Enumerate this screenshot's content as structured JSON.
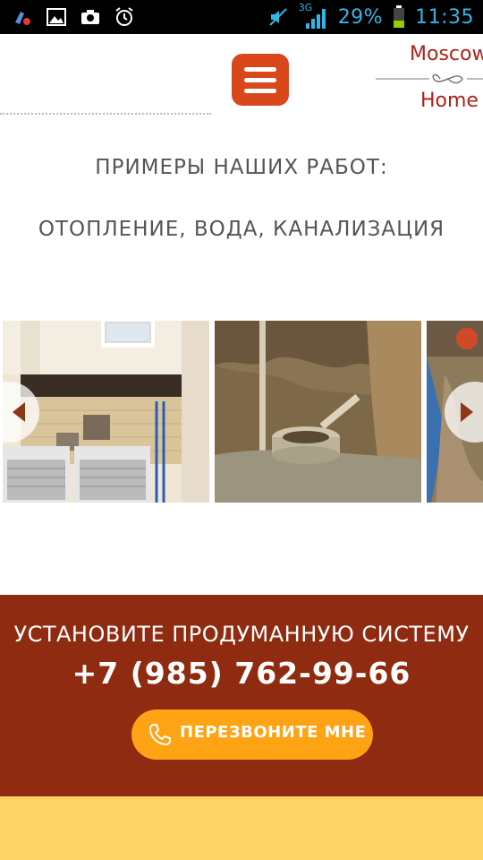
{
  "status_bar": {
    "network": "3G",
    "battery": "29%",
    "time": "11:35",
    "icons": [
      "cleaner-app-icon",
      "gallery-icon",
      "camera-icon",
      "alarm-icon",
      "mute-icon",
      "signal-icon",
      "battery-icon"
    ]
  },
  "header": {
    "menu_icon": "hamburger-menu-icon",
    "logo_top": "Moscow",
    "logo_bottom": "Home"
  },
  "section": {
    "heading_line1": "ПРИМЕРЫ НАШИХ РАБОТ:",
    "heading_line2": "ОТОПЛЕНИЕ, ВОДА, КАНАЛИЗАЦИЯ"
  },
  "gallery": {
    "prev_icon": "chevron-left-icon",
    "next_icon": "chevron-right-icon",
    "slides": [
      "house-with-ac-units",
      "concrete-well-pit",
      "excavation-site"
    ]
  },
  "cta": {
    "title": "УСТАНОВИТЕ ПРОДУМАННУЮ СИСТЕМУ",
    "phone": "+7 (985) 762-99-66",
    "button_label": "ПЕРЕЗВОНИТЕ МНЕ",
    "button_icon": "phone-icon"
  },
  "colors": {
    "accent": "#d9471b",
    "cta_bg": "#8f2b10",
    "button": "#fda314",
    "footer_band": "#ffd466"
  }
}
